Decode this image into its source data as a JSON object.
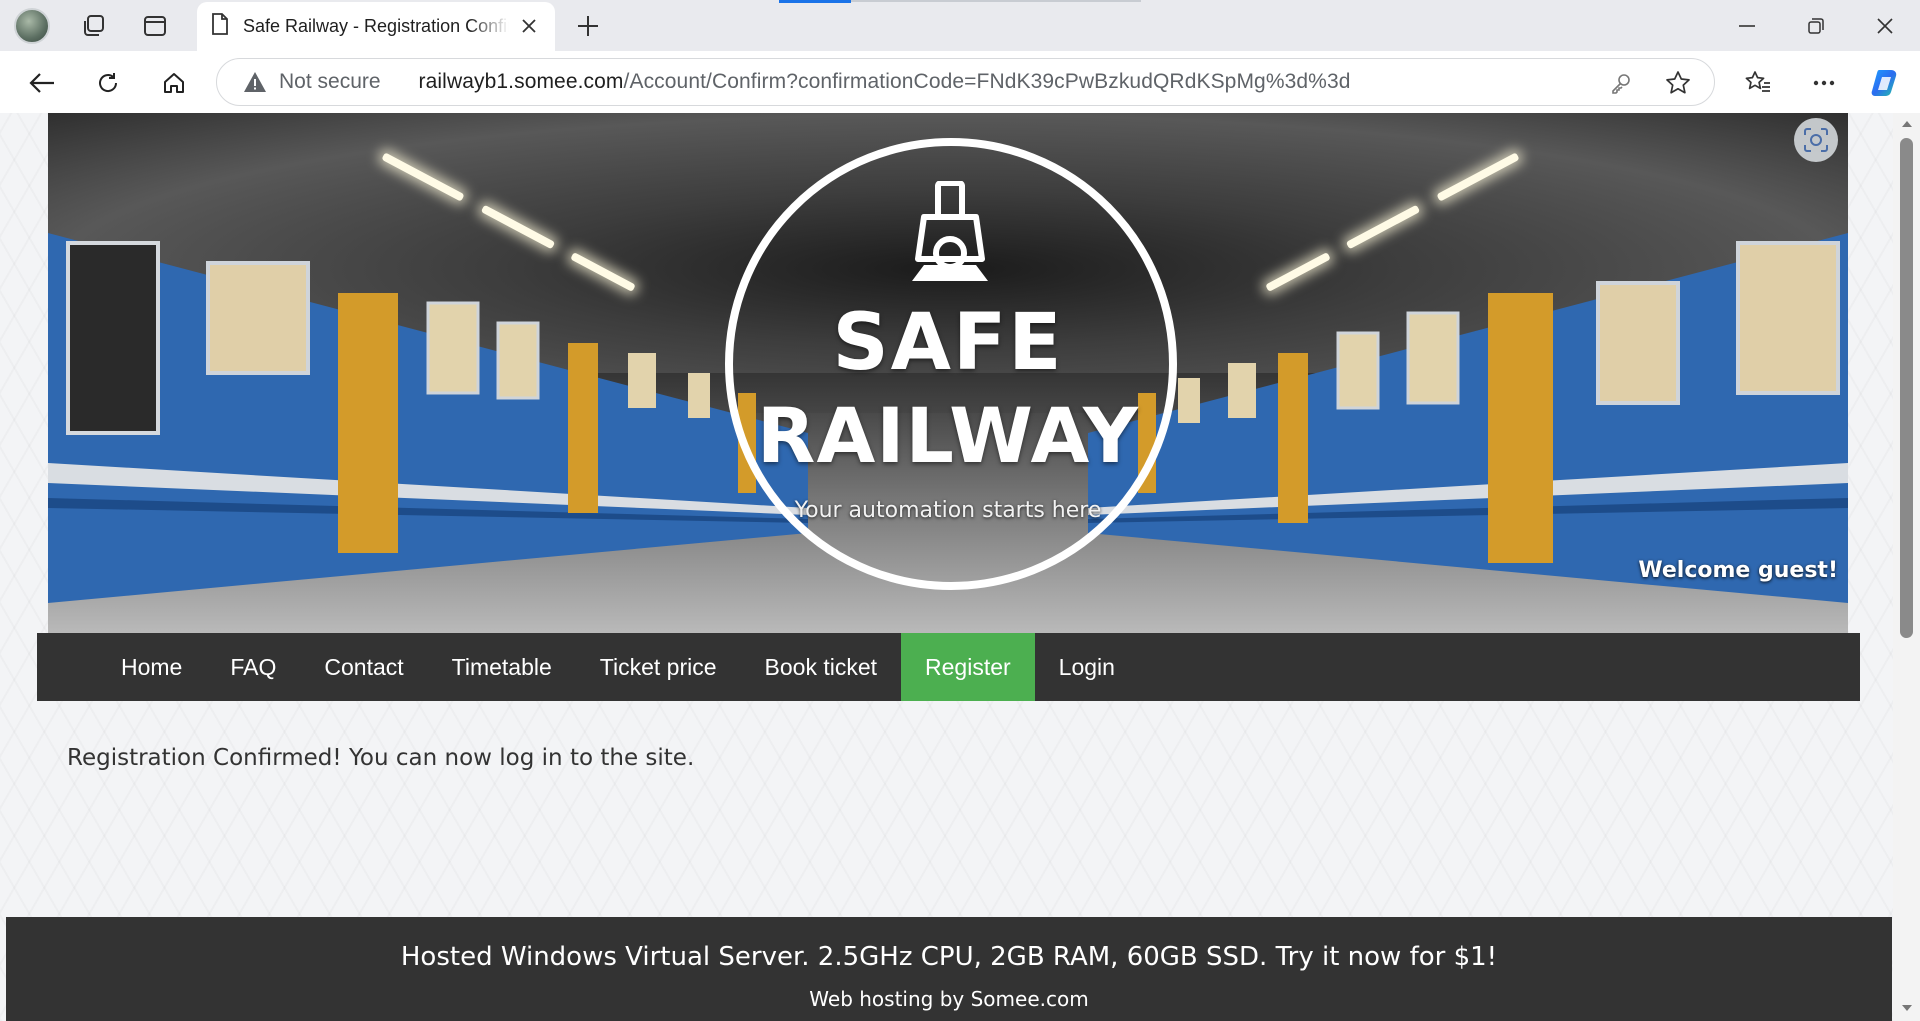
{
  "browser": {
    "tab_title": "Safe Railway - Registration Confirmed",
    "not_secure_label": "Not secure",
    "url_host": "railwayb1.somee.com",
    "url_path": "/Account/Confirm?confirmationCode=FNdK39cPwBzkudQRdKSpMg%3d%3d",
    "icons": [
      "profile-avatar",
      "workspaces-icon",
      "tab-actions-icon",
      "page-icon",
      "close-icon",
      "plus-icon",
      "minimize-icon",
      "restore-icon",
      "close-window-icon",
      "back-icon",
      "refresh-icon",
      "home-icon",
      "warning-icon",
      "key-icon",
      "star-icon",
      "favorites-icon",
      "more-icon",
      "copilot-icon"
    ]
  },
  "banner": {
    "brand_line1": "SAFE",
    "brand_line2": "RAILWAY",
    "tagline": "Your automation starts here",
    "welcome": "Welcome guest!"
  },
  "menu": {
    "items": [
      {
        "label": "Home"
      },
      {
        "label": "FAQ"
      },
      {
        "label": "Contact"
      },
      {
        "label": "Timetable"
      },
      {
        "label": "Ticket price"
      },
      {
        "label": "Book ticket"
      },
      {
        "label": "Register",
        "active": true
      },
      {
        "label": "Login"
      }
    ],
    "active_color": "#4caf50",
    "bar_color": "#333333"
  },
  "content": {
    "message": "Registration Confirmed! You can now log in to the site."
  },
  "footer": {
    "promo": "Hosted Windows Virtual Server. 2.5GHz CPU, 2GB RAM, 60GB SSD. Try it now for $1!",
    "hosting": "Web hosting by Somee.com"
  }
}
